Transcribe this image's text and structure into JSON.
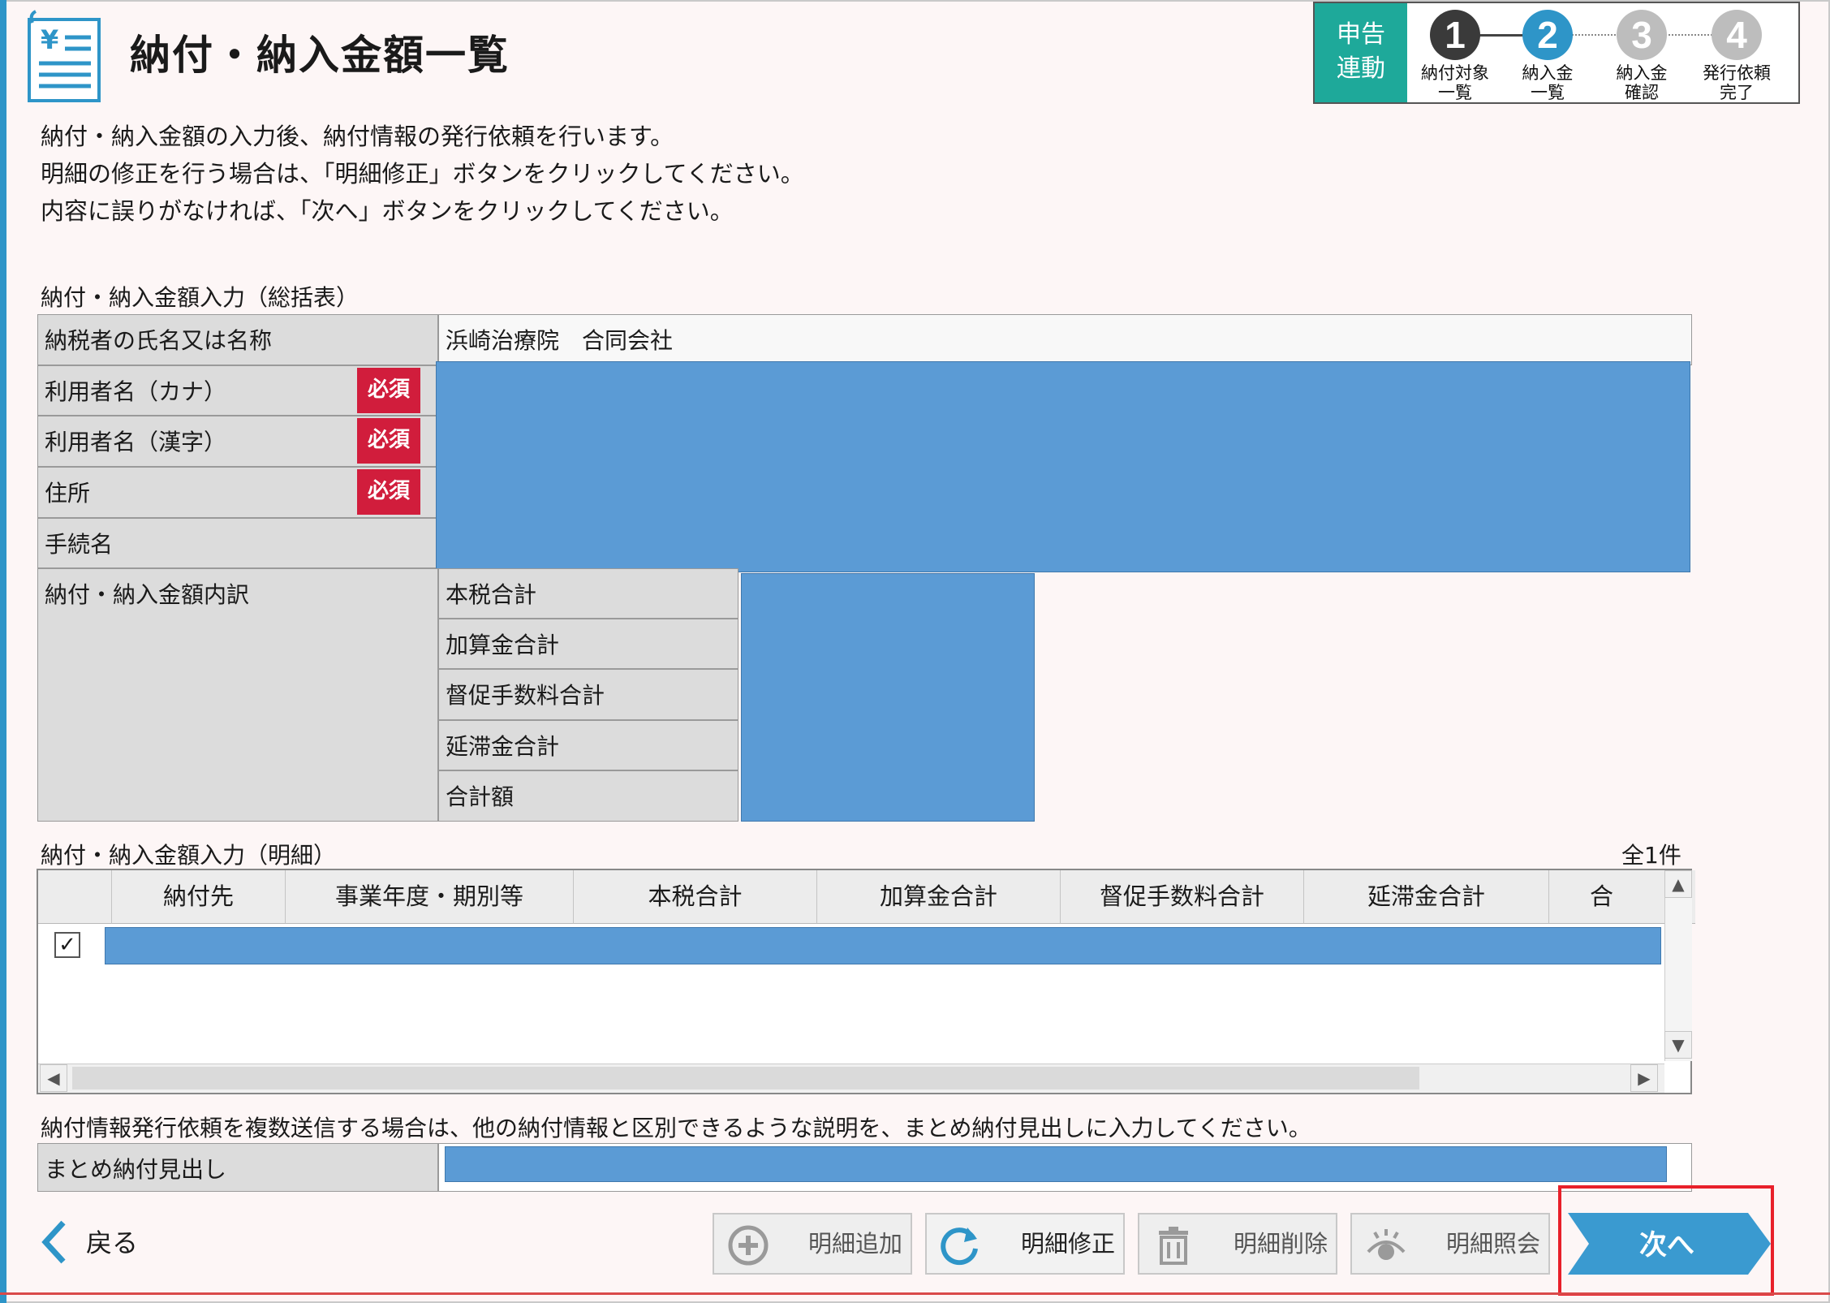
{
  "header": {
    "title": "納付・納入金額一覧",
    "steps_label_line1": "申告",
    "steps_label_line2": "連動",
    "steps": [
      {
        "num": "1",
        "line1": "納付対象",
        "line2": "一覧",
        "color": "#3a3a3a"
      },
      {
        "num": "2",
        "line1": "納入金",
        "line2": "一覧",
        "color": "#2e95c8"
      },
      {
        "num": "3",
        "line1": "納入金",
        "line2": "確認",
        "color": "#bdbdbd"
      },
      {
        "num": "4",
        "line1": "発行依頼",
        "line2": "完了",
        "color": "#bdbdbd"
      }
    ]
  },
  "description": [
    "納付・納入金額の入力後、納付情報の発行依頼を行います。",
    "明細の修正を行う場合は、「明細修正」ボタンをクリックしてください。",
    "内容に誤りがなければ、「次へ」ボタンをクリックしてください。"
  ],
  "summary": {
    "section_label": "納付・納入金額入力（総括表）",
    "taxpayer_label": "納税者の氏名又は名称",
    "taxpayer_value": "浜崎治療院　合同会社",
    "user_kana_label": "利用者名（カナ）",
    "user_kanji_label": "利用者名（漢字）",
    "address_label": "住所",
    "procedure_label": "手続名",
    "required_badge": "必須",
    "breakdown_label": "納付・納入金額内訳",
    "breakdown_rows": [
      "本税合計",
      "加算金合計",
      "督促手数料合計",
      "延滞金合計",
      "合計額"
    ]
  },
  "detail": {
    "section_label": "納付・納入金額入力（明細）",
    "count_text": "全1件",
    "columns": [
      "納付先",
      "事業年度・期別等",
      "本税合計",
      "加算金合計",
      "督促手数料合計",
      "延滞金合計",
      "合"
    ]
  },
  "summary_heading": {
    "note": "納付情報発行依頼を複数送信する場合は、他の納付情報と区別できるような説明を、まとめ納付見出しに入力してください。",
    "label": "まとめ納付見出し"
  },
  "footer": {
    "back_label": "戻る",
    "add_label": "明細追加",
    "edit_label": "明細修正",
    "delete_label": "明細削除",
    "view_label": "明細照会",
    "next_label": "次へ"
  },
  "colors": {
    "accent": "#2e95c8",
    "teal": "#1ea99a",
    "required": "#d11d3c",
    "redaction": "#5b9bd5",
    "highlight": "#e8202a"
  }
}
